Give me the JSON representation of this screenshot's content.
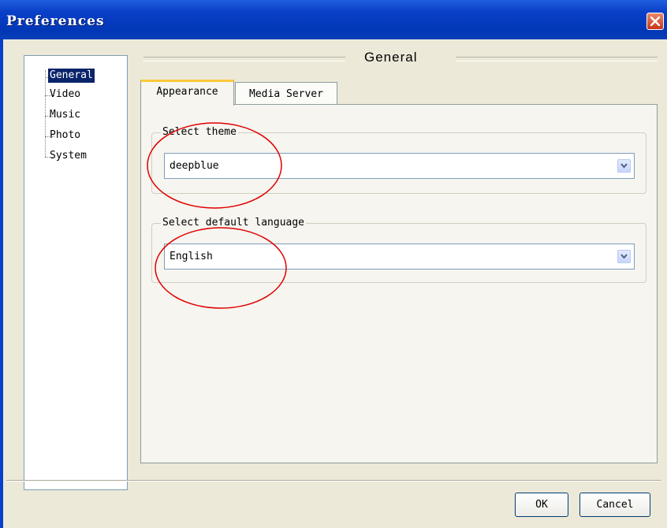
{
  "window": {
    "title": "Preferences"
  },
  "tree": {
    "items": [
      "General",
      "Video",
      "Music",
      "Photo",
      "System"
    ],
    "selected": "General"
  },
  "section": {
    "title": "General"
  },
  "tabs": [
    {
      "label": "Appearance",
      "active": true
    },
    {
      "label": "Media Server",
      "active": false
    }
  ],
  "theme": {
    "group_label": "Select theme",
    "value": "deepblue"
  },
  "language": {
    "group_label": "Select default language",
    "value": "English"
  },
  "buttons": {
    "ok": "OK",
    "cancel": "Cancel"
  },
  "colors": {
    "titlebar": "#0a3fc8",
    "annotation": "#e00000",
    "tab_highlight": "#ffc83c",
    "selection": "#0a246a"
  },
  "icons": {
    "close": "close-icon",
    "dropdown": "chevron-down-icon"
  }
}
